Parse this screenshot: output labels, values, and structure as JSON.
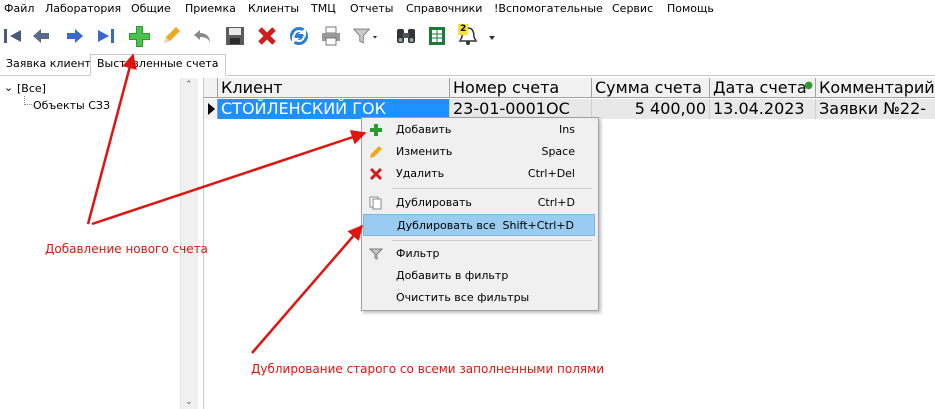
{
  "menubar": {
    "items": [
      "Файл",
      "Лаборатория",
      "Общие",
      "Приемка",
      "Клиенты",
      "ТМЦ",
      "Отчеты",
      "Справочники",
      "!Вспомогательные",
      "Сервис",
      "Помощь"
    ]
  },
  "toolbar": {
    "buttons": [
      "first-icon",
      "prev-icon",
      "next-icon",
      "last-icon",
      "add-icon",
      "edit-icon",
      "undo-icon",
      "save-icon",
      "delete-icon",
      "refresh-icon",
      "print-icon",
      "filter-icon",
      "binoculars-icon",
      "excel-icon",
      "bell-icon"
    ],
    "bell_badge": "2"
  },
  "tabs": [
    "Заявка клиента",
    "Выставленные счета"
  ],
  "tree": {
    "root": "[Все]",
    "child": "Объекты СЗЗ"
  },
  "grid": {
    "columns": [
      "Клиент",
      "Номер счета",
      "Сумма счета",
      "Дата счета",
      "Комментарий"
    ],
    "rows": [
      [
        "СТОЙЛЕНСКИЙ ГОК",
        "23-01-0001ОС",
        "5 400,00",
        "13.04.2023",
        "Заявки №22-"
      ]
    ]
  },
  "context_menu": {
    "items": [
      {
        "label": "Добавить",
        "shortcut": "Ins",
        "icon": "add-icon"
      },
      {
        "label": "Изменить",
        "shortcut": "Space",
        "icon": "edit-icon"
      },
      {
        "label": "Удалить",
        "shortcut": "Ctrl+Del",
        "icon": "delete-icon"
      },
      {
        "label": "Дублировать",
        "shortcut": "Ctrl+D",
        "icon": "copy-icon"
      },
      {
        "label": "Дублировать все",
        "shortcut": "Shift+Ctrl+D",
        "icon": ""
      },
      {
        "label": "Фильтр",
        "shortcut": "",
        "icon": "filter-icon"
      },
      {
        "label": "Добавить в фильтр",
        "shortcut": "",
        "icon": ""
      },
      {
        "label": "Очистить все фильтры",
        "shortcut": "",
        "icon": ""
      }
    ]
  },
  "annotations": {
    "add_note": "Добавление нового счета",
    "dup_note": "Дублирование старого со всеми заполненными полями"
  },
  "colors": {
    "selection": "#1e90ff",
    "menu_highlight": "#99ccf0",
    "annotation": "#e0140e"
  }
}
